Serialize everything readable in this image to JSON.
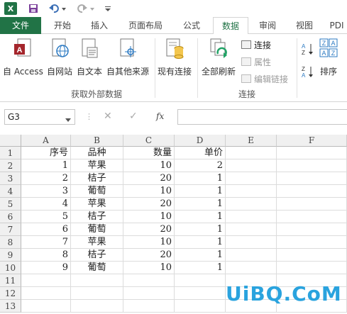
{
  "qat": {
    "logo_text": "X"
  },
  "tabs": [
    {
      "label": "文件"
    },
    {
      "label": "开始"
    },
    {
      "label": "插入"
    },
    {
      "label": "页面布局"
    },
    {
      "label": "公式"
    },
    {
      "label": "数据"
    },
    {
      "label": "审阅"
    },
    {
      "label": "视图"
    },
    {
      "label": "PDI"
    }
  ],
  "ribbon": {
    "external_group": {
      "buttons": [
        {
          "label": "自 Access"
        },
        {
          "label": "自网站"
        },
        {
          "label": "自文本"
        },
        {
          "label": "自其他来源"
        }
      ],
      "group_label": "获取外部数据"
    },
    "existing_conn_label": "现有连接",
    "connections_group": {
      "refresh_label": "全部刷新",
      "connect_label": "连接",
      "properties_label": "属性",
      "edit_links_label": "编辑链接",
      "group_label": "连接"
    },
    "sort_label": "排序",
    "accent_color": "#217346"
  },
  "formula_bar": {
    "name_box": "G3",
    "fx_label": "fx",
    "value": ""
  },
  "sheet": {
    "columns": [
      "A",
      "B",
      "C",
      "D",
      "E",
      "F"
    ],
    "row_numbers": [
      "1",
      "2",
      "3",
      "4",
      "5",
      "6",
      "7",
      "8",
      "9",
      "10",
      "11",
      "12",
      "13"
    ],
    "header": [
      "序号",
      "品种",
      "数量",
      "单价"
    ],
    "rows": [
      [
        "1",
        "苹果",
        "10",
        "2"
      ],
      [
        "2",
        "桔子",
        "20",
        "1"
      ],
      [
        "3",
        "葡萄",
        "10",
        "1"
      ],
      [
        "4",
        "苹果",
        "20",
        "1"
      ],
      [
        "5",
        "桔子",
        "10",
        "1"
      ],
      [
        "6",
        "葡萄",
        "20",
        "1"
      ],
      [
        "7",
        "苹果",
        "10",
        "1"
      ],
      [
        "8",
        "桔子",
        "20",
        "1"
      ],
      [
        "9",
        "葡萄",
        "10",
        "1"
      ]
    ]
  },
  "watermark": "UiBQ.CoM"
}
